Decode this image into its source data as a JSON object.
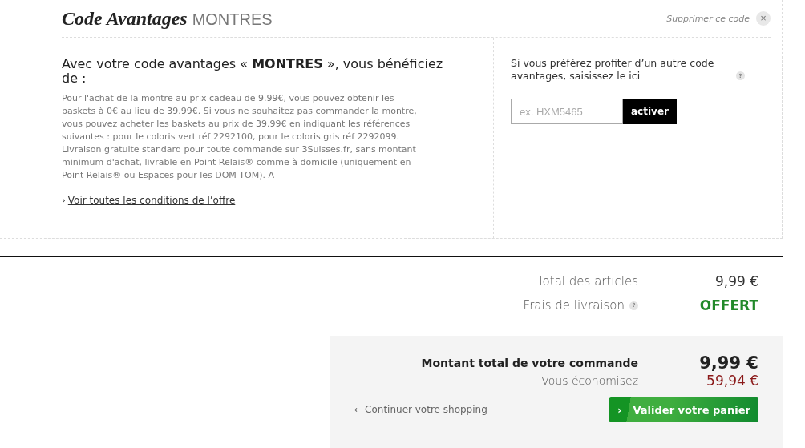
{
  "promo": {
    "title": "Code Avantages",
    "code": "MONTRES",
    "remove_label": "Supprimer ce code",
    "remove_icon": "×",
    "heading": "Avec votre code avantages « **MONTRES** », vous bénéficiez de :",
    "description": "Pour l'achat de la montre au prix cadeau de 9.99€, vous pouvez obtenir les baskets à 0€ au lieu de 39.99€. Si vous ne souhaitez pas commander la montre, vous pouvez acheter les baskets au prix de 39.99€ en indiquant les références suivantes : pour le coloris vert réf 2292100, pour le coloris gris réf 2292099.\nLivraison gratuite standard pour toute commande sur 3Suisses.fr, sans montant minimum d'achat, livrable en Point Relais® comme à domicile (uniquement en Point Relais® ou Espaces pour les DOM TOM). A",
    "conditions_marker": "›",
    "conditions_link": "Voir toutes les conditions de l’offre",
    "other_code_text": "Si vous préférez profiter d’un autre code avantages, saisissez le ici",
    "help_icon": "?",
    "code_field": {
      "placeholder": "ex. HXM5465"
    },
    "activate_button": "activer"
  },
  "summary": {
    "rows": [
      {
        "kind": "plain",
        "label": "Total des articles",
        "value": "9,99 €"
      },
      {
        "kind": "free",
        "label": "Frais de livraison",
        "value": "OFFERT",
        "help_icon": "?"
      }
    ]
  },
  "total": {
    "label": "Montant total de votre commande",
    "value": "9,99 €",
    "savings_label": "Vous économisez",
    "savings_value": "59,94 €",
    "continue_arrow": "←",
    "continue_link": "Continuer votre shopping",
    "validate_chevron": "›",
    "validate_button": "Valider votre panier"
  }
}
